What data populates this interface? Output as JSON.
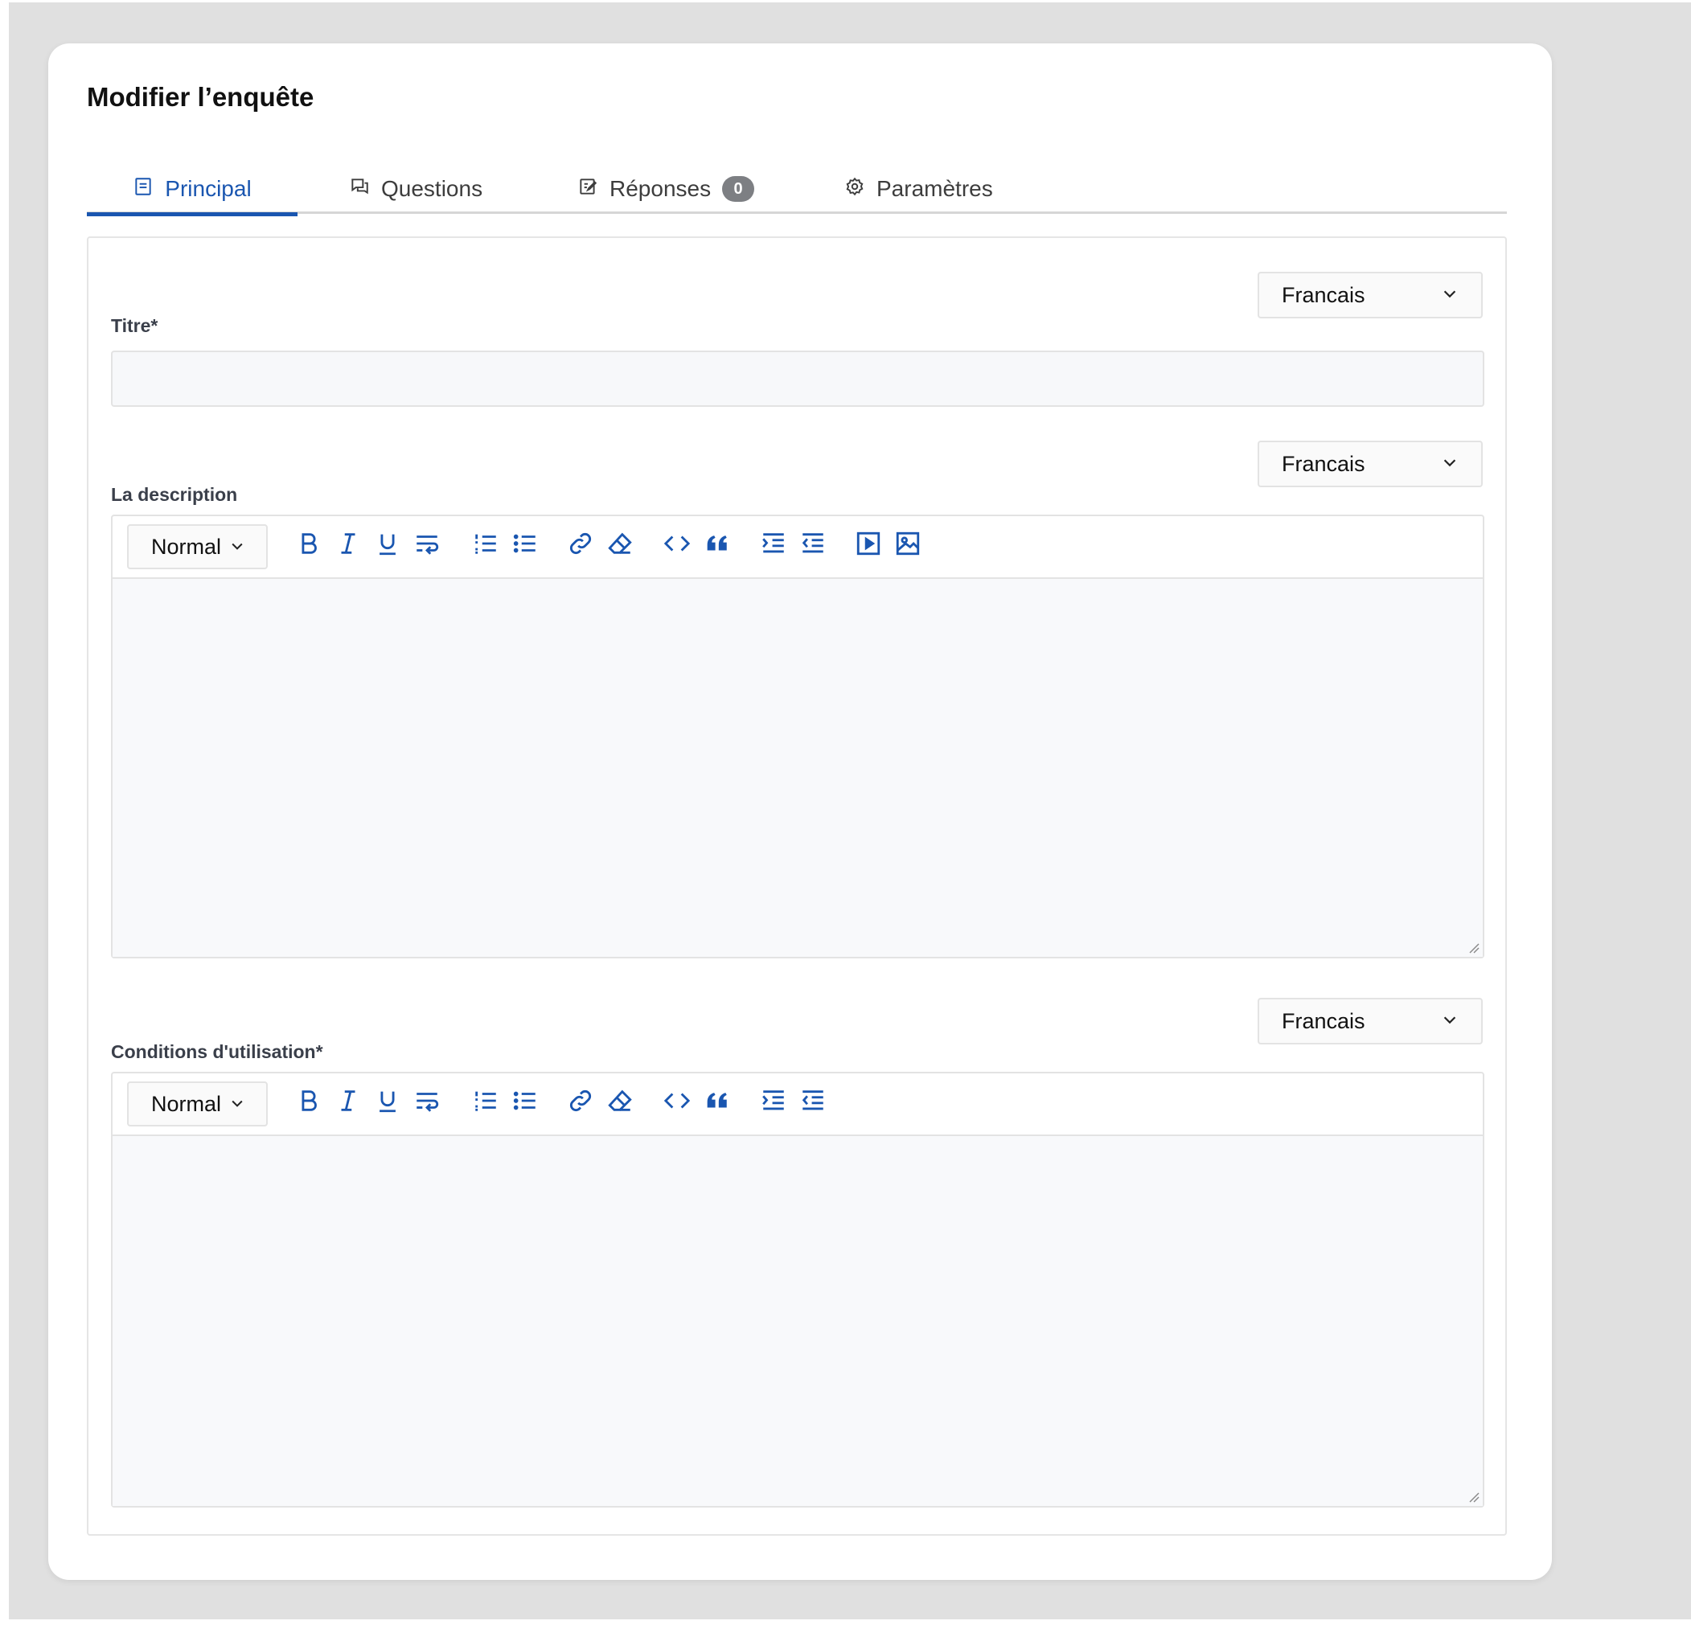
{
  "page": {
    "title": "Modifier l’enquête"
  },
  "tabs": [
    {
      "label": "Principal",
      "icon": "document-icon",
      "active": true
    },
    {
      "label": "Questions",
      "icon": "chat-icon"
    },
    {
      "label": "Réponses",
      "icon": "edit-note-icon",
      "badge": "0"
    },
    {
      "label": "Paramètres",
      "icon": "gear-icon"
    }
  ],
  "form": {
    "title_field": {
      "label": "Titre*",
      "value": "",
      "language": "Francais"
    },
    "description_field": {
      "label": "La description",
      "language": "Francais",
      "format": "Normal"
    },
    "conditions_field": {
      "label": "Conditions d'utilisation*",
      "language": "Francais",
      "format": "Normal"
    }
  },
  "colors": {
    "accent": "#1a56b0",
    "badge": "#7d7f83",
    "background": "#e0e0e0"
  }
}
